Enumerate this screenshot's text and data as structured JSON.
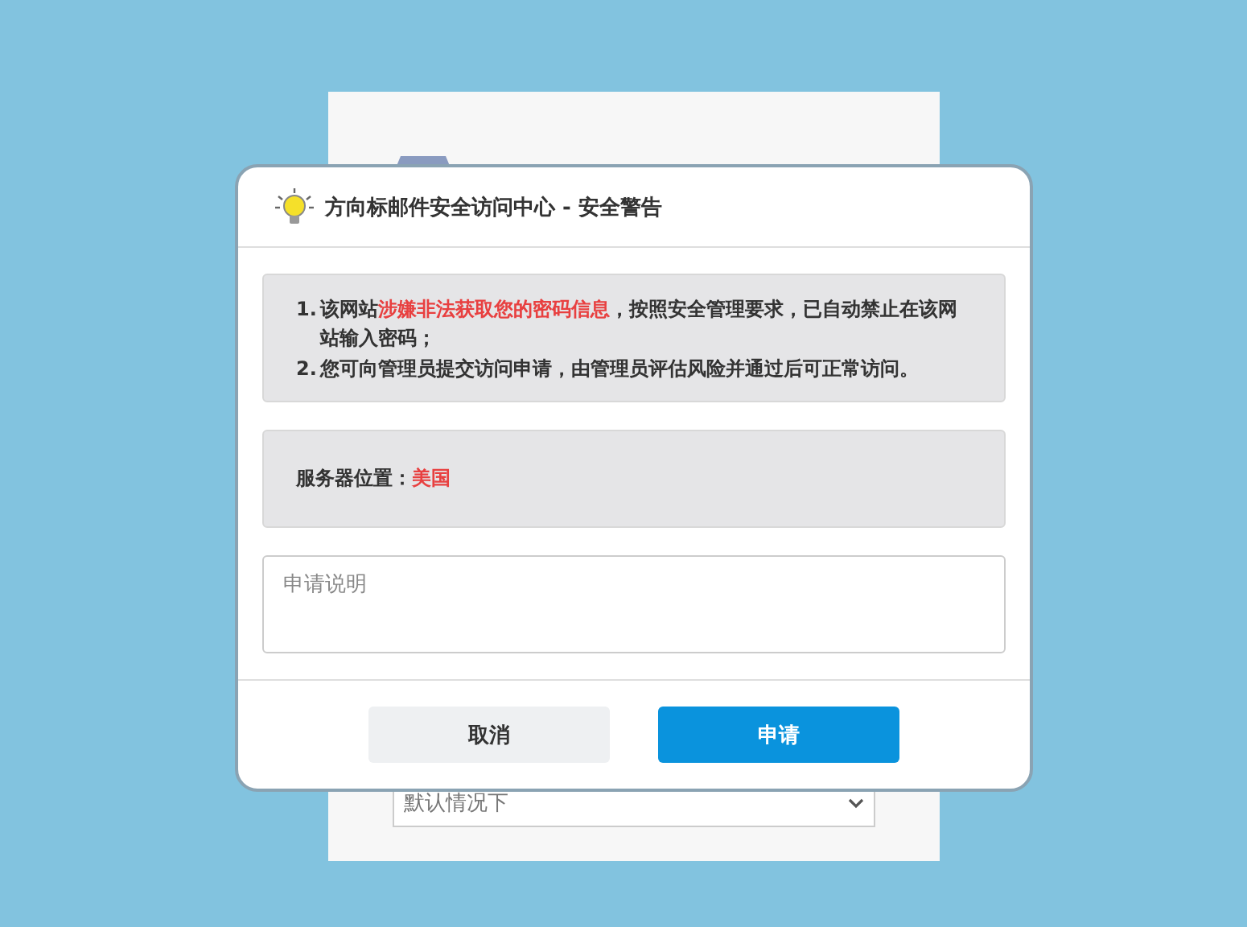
{
  "background_page": {
    "dropdown": {
      "value": "默认情况下"
    }
  },
  "dialog": {
    "title": "方向标邮件安全访问中心 - 安全警告",
    "notices": [
      {
        "number": "1.",
        "segments": [
          {
            "kind": "normal",
            "text": "该网站"
          },
          {
            "kind": "alert",
            "text": "涉嫌非法获取您的密码信息"
          },
          {
            "kind": "normal",
            "text": "，按照安全管理要求，已自动禁止在该网站输入密码；"
          }
        ]
      },
      {
        "number": "2.",
        "segments": [
          {
            "kind": "normal",
            "text": "您可向管理员提交访问申请，由管理员评估风险并通过后可正常访问。"
          }
        ]
      }
    ],
    "server": {
      "label": "服务器位置：",
      "value": "美国"
    },
    "reason_field": {
      "placeholder": "申请说明"
    },
    "buttons": [
      {
        "kind": "secondary",
        "label": "取消"
      },
      {
        "kind": "primary",
        "label": "申请"
      }
    ]
  }
}
